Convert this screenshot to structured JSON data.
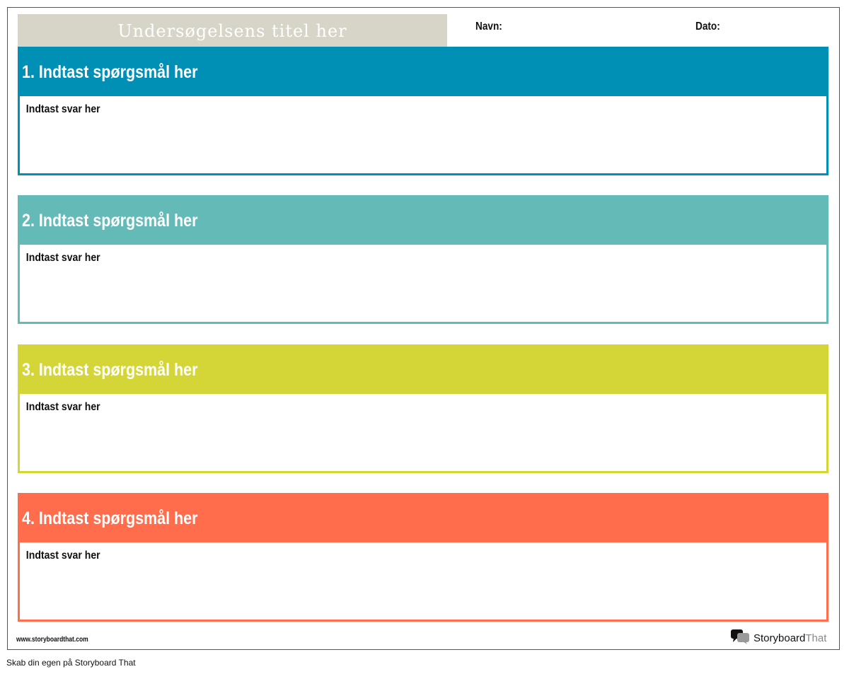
{
  "worksheet": {
    "title": "Undersøgelsens titel her",
    "name_label": "Navn:",
    "date_label": "Dato:"
  },
  "questions": [
    {
      "title": "1. Indtast spørgsmål her",
      "answer": "Indtast svar her",
      "color": "#0090b5"
    },
    {
      "title": "2. Indtast spørgsmål her",
      "answer": "Indtast svar her",
      "color": "#64bab7"
    },
    {
      "title": "3. Indtast spørgsmål her",
      "answer": "Indtast svar her",
      "color": "#d4d638"
    },
    {
      "title": "4. Indtast spørgsmål her",
      "answer": "Indtast svar her",
      "color": "#ff6d4d"
    }
  ],
  "footer": {
    "url": "www.storyboardthat.com",
    "logo_primary": "Storyboard",
    "logo_secondary": "That",
    "logo_icon": "speech-bubbles-icon"
  },
  "credit": "Skab din egen på Storyboard That"
}
